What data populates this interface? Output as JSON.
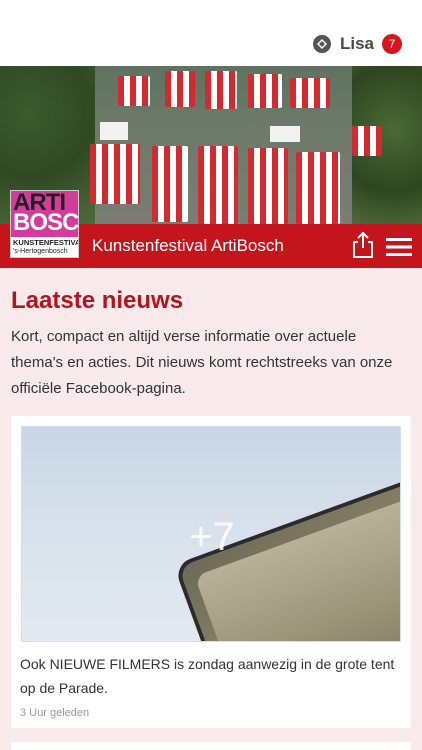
{
  "header": {
    "user_name": "Lisa",
    "notification_count": "7",
    "user_icon": "sync-icon"
  },
  "banner": {
    "title": "Kunstenfestival ArtiBosch",
    "share_icon": "share-icon",
    "menu_icon": "hamburger-menu-icon",
    "accent_color": "#c4141c"
  },
  "logo": {
    "word1": "ARTI",
    "word2": "BOSCH",
    "line1": "KUNSTENFESTIVAL",
    "line2": "'s-Hertogenbosch"
  },
  "main": {
    "heading": "Laatste nieuws",
    "intro": "Kort, compact en altijd verse informatie over actuele thema's en acties. Dit nieuws komt rechtstreeks van onze officiële Facebook-pagina."
  },
  "posts": [
    {
      "image_overlay": "+7",
      "text": "Ook NIEUWE FILMERS is zondag aanwezig in de grote tent op de Parade.",
      "time": "3 Uur geleden"
    }
  ]
}
